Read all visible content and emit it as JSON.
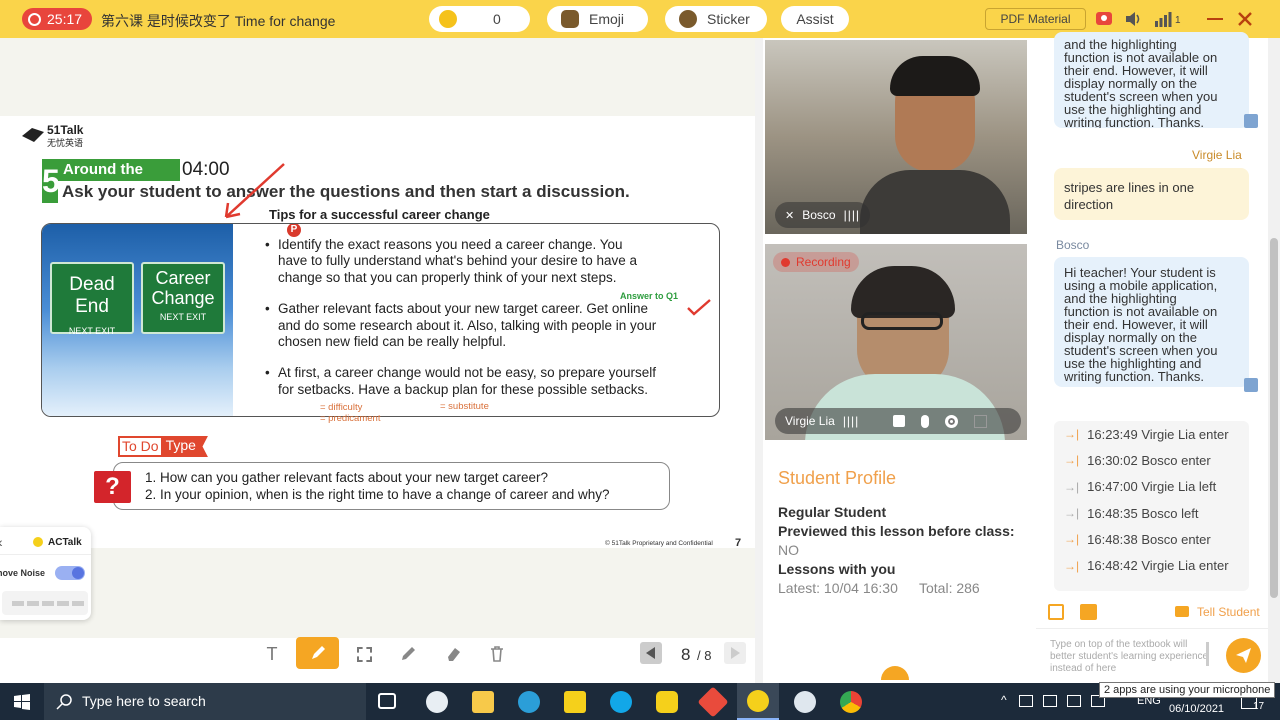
{
  "topbar": {
    "timer": "25:17",
    "lesson_title": "第六课 是时候改变了  Time for change",
    "star_count": "0",
    "emoji_label": "Emoji",
    "sticker_label": "Sticker",
    "assist_label": "Assist",
    "pdf_label": "PDF Material",
    "signal_level": "1"
  },
  "slide": {
    "logo_name": "51Talk",
    "logo_sub": "无忧英语",
    "section_num": "5",
    "section_tag": "Around the world",
    "section_time": "04:00",
    "instruction": "Ask your student to answer the questions and then start a discussion.",
    "card_title": "Tips for a successful career change",
    "sign_left": "Dead End",
    "sign_left_sub": "NEXT EXIT",
    "sign_right_1": "Career",
    "sign_right_2": "Change",
    "sign_right_sub": "NEXT EXIT",
    "bullet1_l1": "Identify the exact reasons you need a career change. You",
    "bullet1_l2": "have to fully understand what's behind your desire to have a",
    "bullet1_l3": "change so that you can properly think of your next steps.",
    "bullet2_l1": "Gather relevant facts about your new target career. Get online",
    "bullet2_l2": "and do some research about it. Also, talking with people in your",
    "bullet2_l3": "chosen new field can be really helpful.",
    "bullet3_l1": "At first, a career change would not be easy, so prepare yourself",
    "bullet3_l2": "for setbacks. Have a backup plan for these possible setbacks.",
    "note_answer": "Answer to Q1",
    "note_difficulty": "= difficulty",
    "note_predicament": "= predicament",
    "note_substitute": "= substitute",
    "todo_a": "To Do",
    "todo_b": "Type",
    "q_mark": "?",
    "q1": "1. How can you gather relevant facts about your new target career?",
    "q2": "2. In your opinion, when is the right time to have a change of career and why?",
    "footer": "© 51Talk  Proprietary and Confidential",
    "page_num": "7",
    "p_marker": "P"
  },
  "actalk": {
    "brand": "ACTalk",
    "noise_label": "Remove Noise",
    "back_icon": "back-chevron-icon"
  },
  "toolbar": {
    "page_current": "8",
    "page_total": "/ 8"
  },
  "videos": {
    "student_name": "Bosco",
    "teacher_name": "Virgie Lia",
    "recording": "Recording"
  },
  "profile": {
    "heading": "Student Profile",
    "type": "Regular Student",
    "previewed_label": "Previewed this lesson before class:",
    "previewed_value": "NO",
    "lessons_label": "Lessons with you",
    "latest": "Latest: 10/04 16:30",
    "total": "Total: 286"
  },
  "chat": {
    "msg_top": [
      "and the highlighting",
      "function is not available on",
      "their end. However, it will",
      "display normally on the",
      "student's screen when you",
      "use the highlighting and",
      "writing function. Thanks."
    ],
    "sender_virgie": "Virgie Lia",
    "msg_virgie": [
      "stripes are lines in one",
      "direction"
    ],
    "sender_bosco": "Bosco",
    "msg_bosco": [
      "Hi teacher! Your student is",
      "using a mobile application,",
      "and the highlighting",
      "function is not available on",
      "their end. However, it will",
      "display normally on the",
      "student's screen when you",
      "use the highlighting and",
      "writing function. Thanks."
    ],
    "log": [
      {
        "text": "16:23:49 Virgie Lia enter",
        "kind": "enter"
      },
      {
        "text": "16:30:02 Bosco enter",
        "kind": "enter"
      },
      {
        "text": "16:47:00 Virgie Lia left",
        "kind": "left"
      },
      {
        "text": "16:48:35 Bosco left",
        "kind": "left"
      },
      {
        "text": "16:48:38 Bosco enter",
        "kind": "enter"
      },
      {
        "text": "16:48:42 Virgie Lia enter",
        "kind": "enter"
      }
    ],
    "tell_student": "Tell Student",
    "input_placeholder": "Type on top of the textbook will better student's learning experience instead of here"
  },
  "taskbar": {
    "search_placeholder": "Type here to search",
    "lang": "ENG",
    "date": "06/10/2021",
    "notif_count": "17",
    "tooltip": "2 apps are using your microphone"
  },
  "colors": {
    "topbar": "#fad44a",
    "accent_orange": "#f5a623",
    "profile_heading": "#f0a04b",
    "timer_red": "#e8453c",
    "chat_blue": "#e6f1fb",
    "chat_yellow": "#fdf4d8"
  }
}
